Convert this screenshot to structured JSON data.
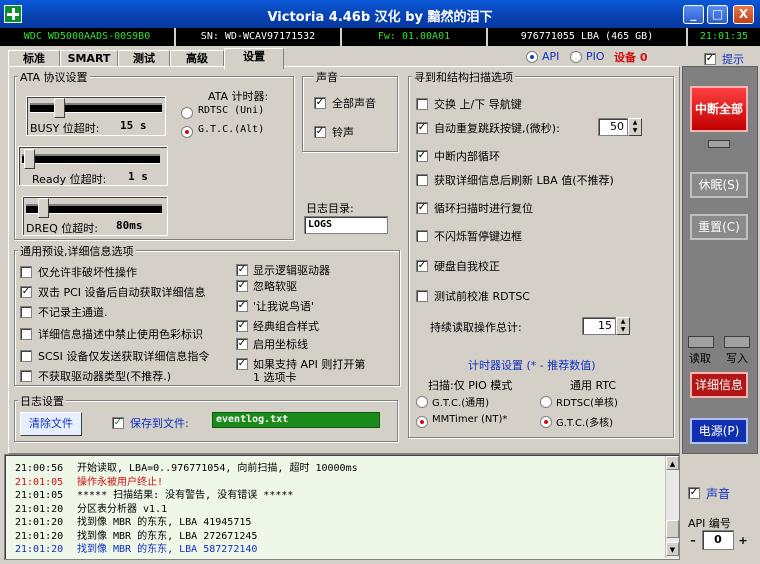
{
  "window": {
    "title": "Victoria 4.46b 汉化 by 黯然的泪下",
    "min_label": "_",
    "max_label": "□",
    "close_label": "X"
  },
  "infobar": {
    "model": "WDC WD5000AADS-00S9B0",
    "serial": "SN: WD-WCAV97171532",
    "firmware": "Fw: 01.00A01",
    "capacity": "976771055 LBA (465 GB)",
    "time": "21:01:35"
  },
  "tabs": [
    "标准",
    "SMART",
    "测试",
    "高级",
    "设置"
  ],
  "mode": {
    "api": "API",
    "pio": "PIO",
    "device": "设备 0",
    "hint": "提示"
  },
  "ata": {
    "title": "ATA 协议设置",
    "busy_label": "BUSY 位超时:",
    "busy_value": "15 s",
    "ready_label": "Ready 位超时:",
    "ready_value": "1 s",
    "dreq_label": "DREQ 位超时:",
    "dreq_value": "80ms",
    "timer_title": "ATA 计时器:",
    "rdtsc": "RDTSC (Uni)",
    "gtc": "G.T.C.(Alt)"
  },
  "sound": {
    "title": "声音",
    "all": "全部声音",
    "bell": "铃声"
  },
  "logdir": {
    "label": "日志目录:",
    "value": "LOGS"
  },
  "general": {
    "title": "通用预设,详细信息选项",
    "left": [
      {
        "label": "仅允许非破坏性操作",
        "checked": false
      },
      {
        "label": "双击 PCI 设备后自动获取详细信息",
        "checked": true
      },
      {
        "label": "不记录主通道.",
        "checked": false
      },
      {
        "label": "详细信息描述中禁止使用色彩标识",
        "checked": false
      },
      {
        "label": "SCSI 设备仅发送获取详细信息指令",
        "checked": false
      },
      {
        "label": "不获取驱动器类型(不推荐.)",
        "checked": false
      }
    ],
    "right": [
      {
        "label": "显示逻辑驱动器",
        "checked": true
      },
      {
        "label": "忽略软驱",
        "checked": true
      },
      {
        "label": "'让我说鸟语'",
        "checked": true
      },
      {
        "label": "经典组合样式",
        "checked": true
      },
      {
        "label": "启用坐标线",
        "checked": true
      },
      {
        "label": "如果支持 API 则打开第",
        "label2": "1 选项卡",
        "checked": true
      }
    ]
  },
  "logset": {
    "title": "日志设置",
    "clear": "清除文件",
    "save_label": "保存到文件:",
    "file": "eventlog.txt"
  },
  "seek": {
    "title": "寻到和结构扫描选项",
    "items": [
      {
        "label": "交换 上/下 导航键",
        "checked": false
      },
      {
        "label": "自动重复跳跃按键,(微秒):",
        "checked": true
      },
      {
        "label": "中断内部循环",
        "checked": true
      },
      {
        "label": "获取详细信息后刷新 LBA 值(不推荐)",
        "checked": false
      },
      {
        "label": "循环扫描时进行复位",
        "checked": true
      },
      {
        "label": "不闪烁暂停键边框",
        "checked": false
      },
      {
        "label": "硬盘自我校正",
        "checked": true
      },
      {
        "label": "测试前校准 RDTSC",
        "checked": false
      }
    ],
    "repeat_value": "50",
    "sum_label": "持续读取操作总计:",
    "sum_value": "15",
    "timer_title": "计时器设置 (* - 推荐数值)",
    "scan_title": "扫描:仅 PIO 模式",
    "gtc_general": "G.T.C.(通用)",
    "mmtimer": "MMTimer (NT)*",
    "rtc_title": "通用 RTC",
    "rdtsc_single": "RDTSC(单核)",
    "gtc_multi": "G.T.C.(多核)"
  },
  "sidebar": {
    "break_all": "中断全部",
    "sleep": "休眠(S)",
    "reset": "重置(C)",
    "read": "读取",
    "write": "写入",
    "details": "详细信息",
    "power": "电源(P)",
    "sound": "声音",
    "api_num_label": "API 编号",
    "api_num": "0"
  },
  "log": [
    {
      "time": "21:00:56",
      "text": "开始读取, LBA=0..976771054, 向前扫描, 超时 10000ms",
      "color": "#000000"
    },
    {
      "time": "21:01:05",
      "text": "操作永被用户终止!",
      "color": "#d01010"
    },
    {
      "time": "21:01:05",
      "text": "***** 扫描结果: 没有警告, 没有错误 *****",
      "color": "#000000"
    },
    {
      "time": "21:01:20",
      "text": "分区表分析器 v1.1",
      "color": "#000000"
    },
    {
      "time": "21:01:20",
      "text": "找到像 MBR 的东东, LBA 41945715",
      "color": "#000000"
    },
    {
      "time": "21:01:20",
      "text": "找到像 MBR 的东东, LBA 272671245",
      "color": "#000000"
    },
    {
      "time": "21:01:20",
      "text": "找到像 MBR 的东东, LBA 587272140",
      "color": "#1030c0"
    }
  ]
}
